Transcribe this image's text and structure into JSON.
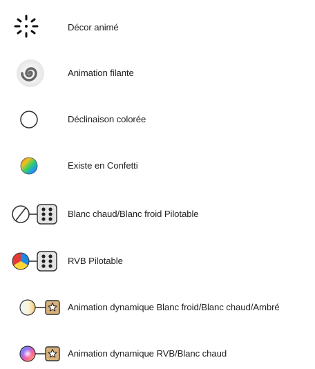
{
  "legend": {
    "items": [
      {
        "icon": "sparkle-icon",
        "label": "Décor animé"
      },
      {
        "icon": "spiral-swirl-icon",
        "label": "Animation filante"
      },
      {
        "icon": "empty-circle-icon",
        "label": "Déclinaison colorée"
      },
      {
        "icon": "rainbow-gradient-circle-icon",
        "label": "Existe en Confetti"
      },
      {
        "icon": "half-circle-with-remote-icon",
        "label": "Blanc chaud/Blanc froid Pilotable"
      },
      {
        "icon": "rgb-pie-with-remote-icon",
        "label": "RVB Pilotable"
      },
      {
        "icon": "pastel-gradient-circle-with-star-box-icon",
        "label": "Animation dynamique Blanc froid/Blanc chaud/Ambré"
      },
      {
        "icon": "color-wheel-circle-with-star-box-icon",
        "label": "Animation dynamique RVB/Blanc chaud"
      }
    ]
  },
  "colors": {
    "text": "#222222",
    "remote_box_fill": "#e3e3e3",
    "remote_dots": "#222222",
    "star_box_fill": "#d8b07a",
    "rgb_red": "#e53935",
    "rgb_blue": "#1e88e5",
    "rgb_yellow": "#fdd835"
  }
}
